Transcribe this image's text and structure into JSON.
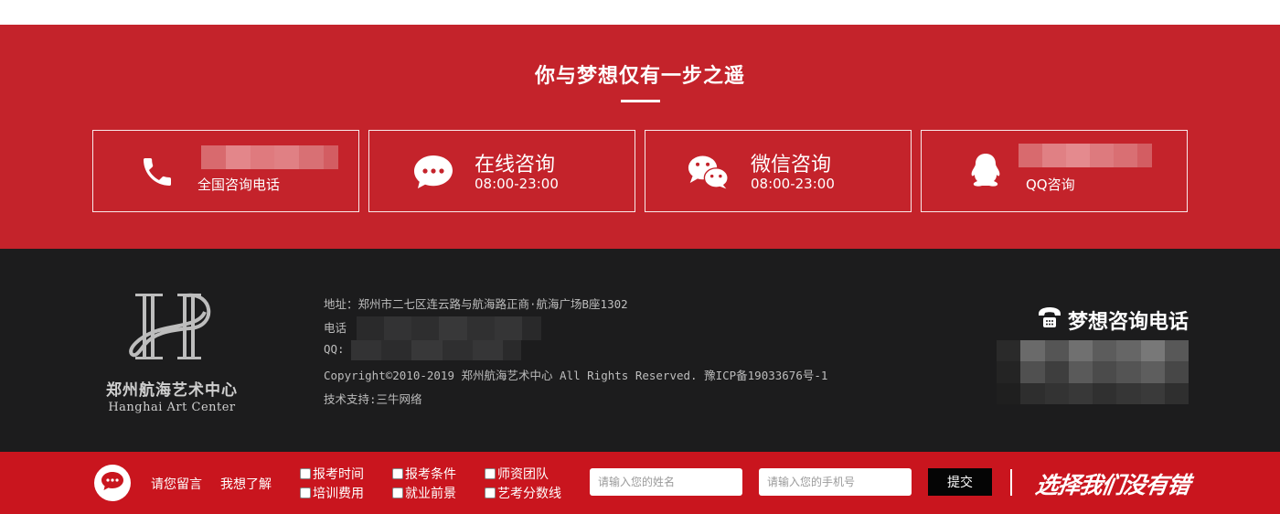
{
  "contact_band": {
    "title": "你与梦想仅有一步之遥",
    "cards": {
      "phone": {
        "sub": "全国咨询电话",
        "icon": "phone-icon"
      },
      "online": {
        "main": "在线咨询",
        "sub": "08:00-23:00",
        "icon": "chat-bubble-icon"
      },
      "wechat": {
        "main": "微信咨询",
        "sub": "08:00-23:00",
        "icon": "wechat-icon"
      },
      "qq": {
        "sub": "QQ咨询",
        "icon": "qq-penguin-icon"
      }
    }
  },
  "footer": {
    "logo_cn": "郑州航海艺术中心",
    "logo_en": "Hanghai Art Center",
    "address": "地址：郑州市二七区连云路与航海路正商·航海广场B座1302",
    "phone_label": "电话",
    "qq_label": "QQ:",
    "copyright": "Copyright©2010-2019 郑州航海艺术中心 All Rights Reserved. 豫ICP备19033676号-1",
    "support": "技术支持:三牛网络",
    "hotline_title": "梦想咨询电话",
    "hotline_icon": "telephone-icon"
  },
  "bottom_bar": {
    "message_label": "请您留言",
    "want_label": "我想了解",
    "options": [
      "报考时间",
      "报考条件",
      "师资团队",
      "培训费用",
      "就业前景",
      "艺考分数线"
    ],
    "name_placeholder": "请输入您的姓名",
    "phone_placeholder": "请输入您的手机号",
    "submit_label": "提交",
    "slogan": "选择我们没有错"
  },
  "colors": {
    "band_red": "#c4232b",
    "footer_dark": "#1c1c1d",
    "bar_red": "#c9151e"
  }
}
